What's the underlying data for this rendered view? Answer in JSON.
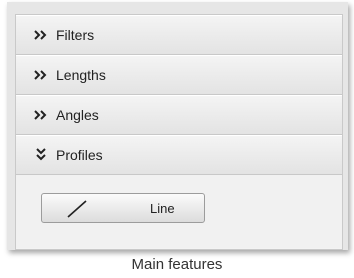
{
  "sections": [
    {
      "label": "Filters",
      "icon": "double-chevron-right-icon",
      "expanded": false
    },
    {
      "label": "Lengths",
      "icon": "double-chevron-right-icon",
      "expanded": false
    },
    {
      "label": "Angles",
      "icon": "double-chevron-right-icon",
      "expanded": false
    },
    {
      "label": "Profiles",
      "icon": "double-chevron-down-icon",
      "expanded": true
    }
  ],
  "profiles": {
    "line_button": {
      "label": "Line",
      "icon": "line-icon"
    }
  },
  "caption": "Main features"
}
